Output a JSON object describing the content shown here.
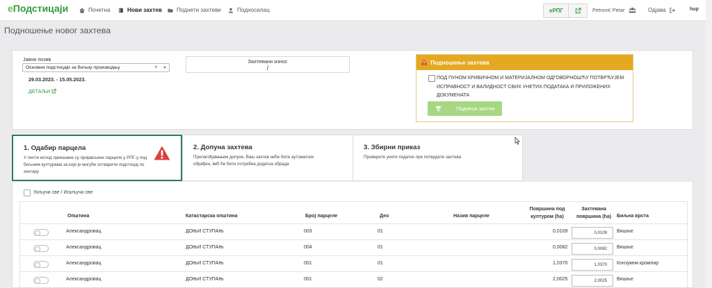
{
  "nav": {
    "logo_prefix": "е",
    "logo_rest": "Подстицаји",
    "items": [
      {
        "label": "Почетна",
        "icon": "home-icon"
      },
      {
        "label": "Нови захтев",
        "icon": "book-icon",
        "active": true
      },
      {
        "label": "Поднети захтеви",
        "icon": "folder-icon"
      },
      {
        "label": "Подносилац",
        "icon": "user-icon"
      }
    ],
    "erpg_label": "еРПГ",
    "user_name": "Petrović Petar",
    "logout": "Одјава",
    "help": "hup"
  },
  "page_title": "Подношење новог захтева",
  "call": {
    "label": "Јавни позив",
    "selected": "Основни подстицаји за биљну производњу",
    "dates": "29.03.2023. - 15.05.2023.",
    "details": "ДЕТАЉИ"
  },
  "amount": {
    "label": "Захтевани износ",
    "value": "/"
  },
  "submission": {
    "title": "Подношење захтева",
    "declaration": "ПОД ПУНОМ КРИВИЧНОМ И МАТЕРИЈАЛНОМ ОДГОВОРНОШЋУ ПОТВРЂУЈЕМ ИСПРАВНОСТ И ВАЛИДНОСТ СВИХ УНЕТИХ ПОДАТАКА И ПРИЛОЖЕНИХ ДОКУМЕНАТА",
    "button": "Поднеси захтев"
  },
  "steps": [
    {
      "title": "1. Одабир парцела",
      "desc_lines": [
        "У листи испод приказане су пријављене парцеле у РПГ-у под",
        "биљним културама за које је могуће остварити подстицај по",
        "хектару"
      ]
    },
    {
      "title": "2. Допуна захтева",
      "desc_lines": [
        "Прилагођавањем допуне, Ваш захтев неће бити аутоматски",
        "обрађен, већ ће бити потребна додатна обрада"
      ]
    },
    {
      "title": "3. Збирни приказ",
      "desc_lines": [
        "Проверите унете податке пре потврдите захтева"
      ]
    }
  ],
  "table": {
    "check_all": "Укључи све / Искључи све",
    "headers": {
      "municipality": "Општина",
      "cadastral": "Катастарска општина",
      "parcel_no": "Број парцеле",
      "part": "Део",
      "parcel_name": "Назив парцеле",
      "area_line1": "Површина под",
      "area_line2": "културом (ha)",
      "req_line1": "Захтевана",
      "req_line2": "површина (ha)",
      "plant": "Биљна врста"
    },
    "rows": [
      {
        "municipality": "Александровац",
        "cadastral": "ДОЊИ СТУПАЊ",
        "parcel_no": "003",
        "part": "01",
        "area": "0,0109",
        "requested": "0,0109",
        "plant": "Вишње"
      },
      {
        "municipality": "Александровац",
        "cadastral": "ДОЊИ СТУПАЊ",
        "parcel_no": "004",
        "part": "01",
        "area": "0,0082",
        "requested": "0,0082",
        "plant": "Вишње"
      },
      {
        "municipality": "Александровац",
        "cadastral": "ДОЊИ СТУПАЊ",
        "parcel_no": "001",
        "part": "01",
        "area": "1,0370",
        "requested": "1,0370",
        "plant": "Конзумни кромпир"
      },
      {
        "municipality": "Александровац",
        "cadastral": "ДОЊИ СТУПАЊ",
        "parcel_no": "001",
        "part": "02",
        "area": "2,0025",
        "requested": "2,0025",
        "plant": "Вишње"
      }
    ]
  },
  "colors": {
    "brand_green": "#2e9c3e",
    "warning_orange": "#e4a821",
    "submit_disabled": "#a6d783",
    "alert_red": "#d9413a"
  }
}
